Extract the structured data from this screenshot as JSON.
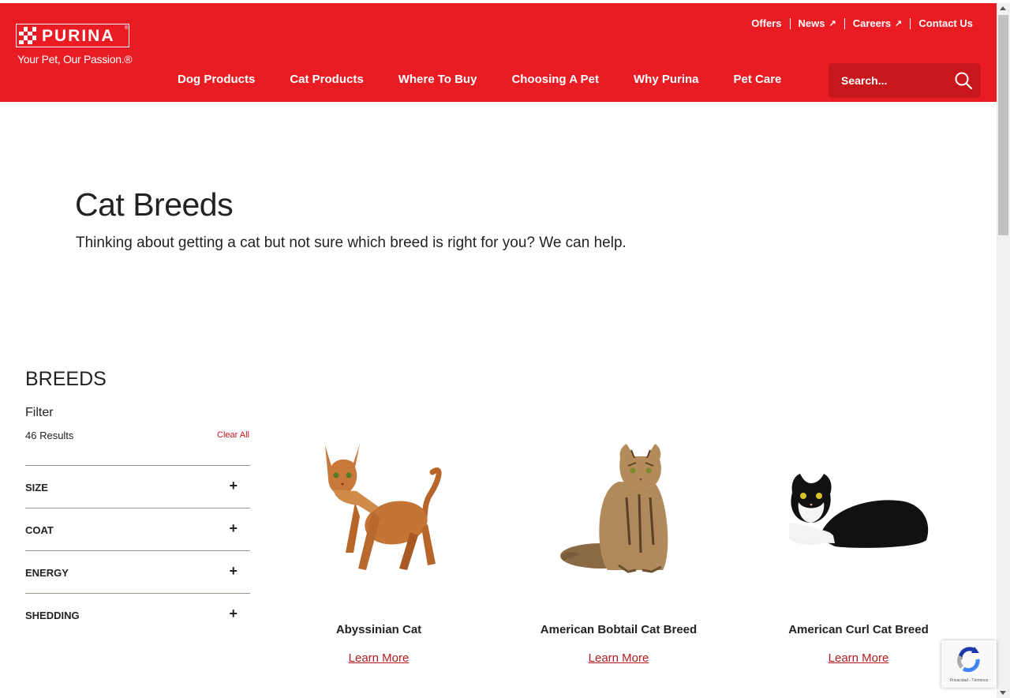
{
  "brand": {
    "name": "PURINA",
    "registered": "®",
    "tagline": "Your Pet, Our Passion.®",
    "color": "#e91c24"
  },
  "utility_nav": [
    {
      "label": "Offers",
      "external": false
    },
    {
      "label": "News",
      "external": true
    },
    {
      "label": "Careers",
      "external": true
    },
    {
      "label": "Contact Us",
      "external": false
    }
  ],
  "main_nav": [
    "Dog Products",
    "Cat Products",
    "Where To Buy",
    "Choosing A Pet",
    "Why Purina",
    "Pet Care"
  ],
  "search": {
    "placeholder": "Search...",
    "icon": "search-icon"
  },
  "hero": {
    "title": "Cat Breeds",
    "subtitle": "Thinking about getting a cat but not sure which breed is right for you? We can help."
  },
  "filters": {
    "heading": "BREEDS",
    "label": "Filter",
    "results": "46 Results",
    "clear_all": "Clear All",
    "facets": [
      "SIZE",
      "COAT",
      "ENERGY",
      "SHEDDING"
    ]
  },
  "breeds": [
    {
      "name": "Abyssinian Cat",
      "link": "Learn More"
    },
    {
      "name": "American Bobtail Cat Breed",
      "link": "Learn More"
    },
    {
      "name": "American Curl Cat Breed",
      "link": "Learn More"
    }
  ],
  "recaptcha": {
    "text": "Privacidad - Términos"
  }
}
